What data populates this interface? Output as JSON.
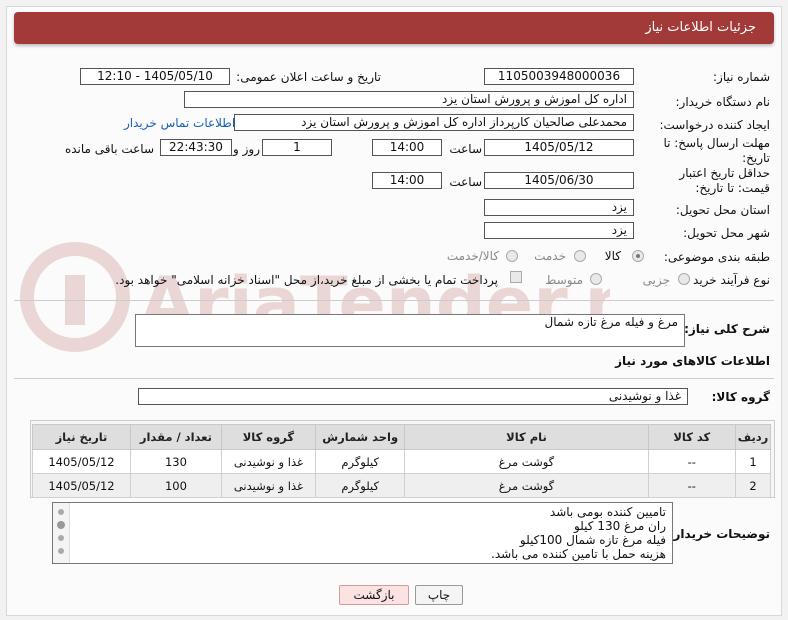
{
  "header": {
    "title": "جزئیات اطلاعات نیاز"
  },
  "fields": {
    "need_number_label": "شماره نیاز:",
    "need_number": "1105003948000036",
    "announce_label": "تاریخ و ساعت اعلان عمومی:",
    "announce_value": "1405/05/10 - 12:10",
    "buyer_org_label": "نام دستگاه خریدار:",
    "buyer_org": "اداره کل اموزش و پرورش استان یزد",
    "requester_label": "ایجاد کننده درخواست:",
    "requester": "محمدعلی صالحیان کارپرداز اداره کل اموزش و پرورش استان یزد",
    "buyer_contact_link": "اطلاعات تماس خریدار",
    "reply_deadline_label": "مهلت ارسال پاسخ: تا تاریخ:",
    "reply_date": "1405/05/12",
    "time_label": "ساعت",
    "reply_time": "14:00",
    "days_value": "1",
    "days_label": "روز و",
    "remaining_time": "22:43:30",
    "remaining_label": "ساعت باقی مانده",
    "price_deadline_label": "حداقل تاریخ اعتبار قیمت: تا تاریخ:",
    "price_date": "1405/06/30",
    "price_time": "14:00",
    "delivery_province_label": "استان محل تحویل:",
    "delivery_province": "یزد",
    "delivery_city_label": "شهر محل تحویل:",
    "delivery_city": "یزد",
    "category_label": "طبقه بندی موضوعی:",
    "category_options": [
      "کالا",
      "خدمت",
      "کالا/خدمت"
    ],
    "category_selected": "کالا",
    "process_label": "نوع فرآیند خرید :",
    "process_options": [
      "جزیی",
      "متوسط"
    ],
    "process_selected": "جزیی",
    "payment_note": "پرداخت تمام یا بخشی از مبلغ خرید،از محل \"اسناد خزانه اسلامی\" خواهد بود."
  },
  "description": {
    "label": "شرح کلی نیاز:",
    "value": "مرغ و فیله مرغ تازه شمال"
  },
  "goods_section": {
    "title": "اطلاعات کالاهای مورد نیاز"
  },
  "goods_group": {
    "label": "گروه کالا:",
    "value": "غذا و نوشیدنی"
  },
  "table": {
    "headers": [
      "ردیف",
      "کد کالا",
      "نام کالا",
      "واحد شمارش",
      "گروه کالا",
      "تعداد / مقدار",
      "تاریخ نیاز"
    ],
    "rows": [
      [
        "1",
        "--",
        "گوشت مرغ",
        "کیلوگرم",
        "غذا و نوشیدنی",
        "130",
        "1405/05/12"
      ],
      [
        "2",
        "--",
        "گوشت مرغ",
        "کیلوگرم",
        "غذا و نوشیدنی",
        "100",
        "1405/05/12"
      ]
    ]
  },
  "buyer_notes": {
    "label": "توضیحات خریدار:",
    "lines": [
      "تامیین کننده بومی باشد",
      "ران مرغ 130 کیلو",
      "فیله مرغ تازه شمال 100کیلو",
      "هزینه حمل با تامین کننده می باشد."
    ]
  },
  "buttons": {
    "print": "چاپ",
    "back": "بازگشت"
  },
  "watermark": {
    "text": "AriaTender.net"
  }
}
